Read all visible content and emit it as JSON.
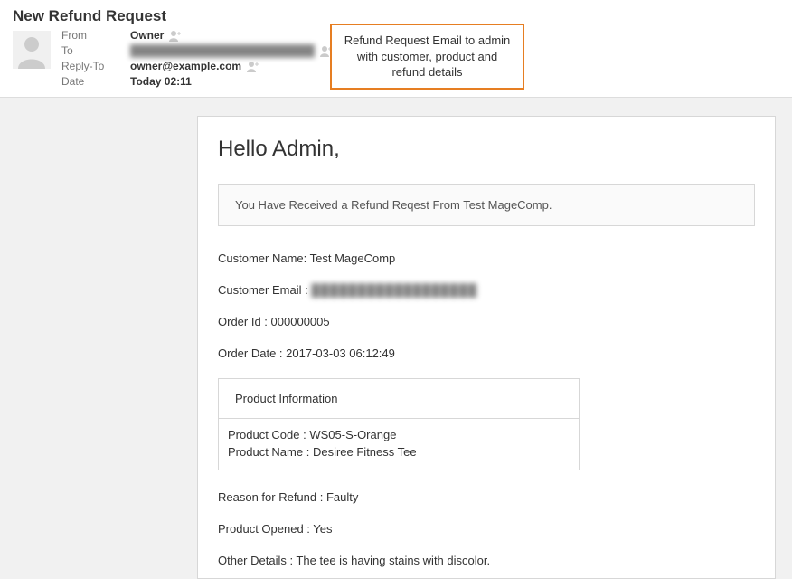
{
  "window_title": "New Refund Request",
  "meta": {
    "from_label": "From",
    "from_value": "Owner",
    "to_label": "To",
    "to_value": "████████████████████████",
    "replyto_label": "Reply-To",
    "replyto_value": "owner@example.com",
    "date_label": "Date",
    "date_value": "Today 02:11"
  },
  "callout": "Refund Request Email to admin with customer, product and refund details",
  "email": {
    "greeting": "Hello Admin,",
    "notice": "You Have Received a Refund Reqest From Test MageComp.",
    "customer_name_label": "Customer Name:",
    "customer_name_value": "Test MageComp",
    "customer_email_label": "Customer Email :",
    "customer_email_value": "██████████████████",
    "order_id_label": "Order Id :",
    "order_id_value": "000000005",
    "order_date_label": "Order Date :",
    "order_date_value": "2017-03-03 06:12:49",
    "product_info_heading": "Product Information",
    "product_code_label": "Product Code :",
    "product_code_value": "WS05-S-Orange",
    "product_name_label": "Product Name :",
    "product_name_value": "Desiree Fitness Tee",
    "reason_label": "Reason for Refund :",
    "reason_value": "Faulty",
    "opened_label": "Product Opened :",
    "opened_value": "Yes",
    "other_label": "Other Details :",
    "other_value": "The tee is having stains with discolor."
  }
}
